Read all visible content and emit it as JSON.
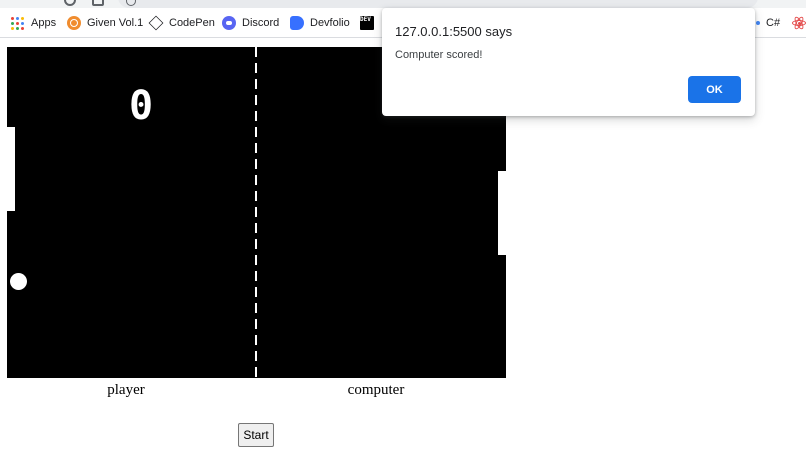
{
  "bookmarks": [
    {
      "label": "Apps",
      "icon": "apps-grid-icon"
    },
    {
      "label": "Given Vol.1",
      "icon": "given-logo-icon"
    },
    {
      "label": "CodePen",
      "icon": "codepen-logo-icon"
    },
    {
      "label": "Discord",
      "icon": "discord-logo-icon"
    },
    {
      "label": "Devfolio",
      "icon": "devfolio-logo-icon"
    },
    {
      "label": "",
      "icon": "dev-logo-icon"
    }
  ],
  "bookmarks_overflow": {
    "csharp_label": "C#",
    "react_icon": "react-logo-icon"
  },
  "dev_badge": "DEV",
  "game": {
    "player_score": "0",
    "player_label": "player",
    "computer_label": "computer",
    "start_label": "Start"
  },
  "alert": {
    "title": "127.0.0.1:5500 says",
    "message": "Computer scored!",
    "ok_label": "OK"
  },
  "colors": {
    "court": "#000000",
    "ok_button": "#1a73e8",
    "paddle": "#ffffff"
  }
}
